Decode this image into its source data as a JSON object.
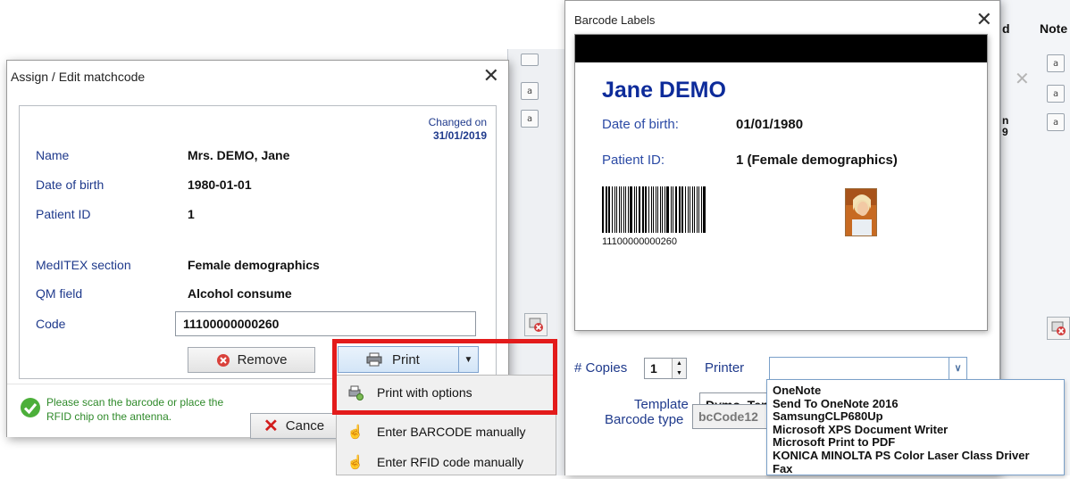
{
  "dialog_assign": {
    "title": "Assign / Edit matchcode",
    "close_symbol": "✕",
    "changed_on_label": "Changed on",
    "changed_on_date": "31/01/2019",
    "fields": [
      {
        "label": "Name",
        "value": "Mrs. DEMO, Jane"
      },
      {
        "label": "Date of birth",
        "value": "1980-01-01"
      },
      {
        "label": "Patient ID",
        "value": "1"
      },
      {
        "label": "MedITEX section",
        "value": "Female demographics"
      },
      {
        "label": "QM field",
        "value": "Alcohol consume"
      }
    ],
    "code_label": "Code",
    "code_value": "11100000000260",
    "remove_label": "Remove",
    "print_label": "Print",
    "cancel_label": "Cance",
    "status_message": "Please scan the barcode or place the RFID chip on the antenna."
  },
  "print_menu": {
    "items": [
      {
        "label": "Print with options",
        "icon": "print-options-icon"
      },
      {
        "label": "Enter BARCODE manually",
        "icon": "hand-icon"
      },
      {
        "label": "Enter RFID code manually",
        "icon": "hand-icon"
      }
    ]
  },
  "dialog_barcode": {
    "title": "Barcode Labels",
    "close_symbol": "✕",
    "card": {
      "name": "Jane DEMO",
      "dob_label": "Date of birth:",
      "dob_value": "01/01/1980",
      "pid_label": "Patient ID:",
      "pid_value": "1 (Female demographics)",
      "barcode_number": "11100000000260"
    },
    "copies_label": "# Copies",
    "copies_value": "1",
    "printer_label": "Printer",
    "printer_value": "",
    "template_label": "Template",
    "template_value": "Dymo_Ten",
    "barcode_type_label": "Barcode type",
    "barcode_type_value": "bcCode12",
    "printer_options": [
      "OneNote",
      "Send To OneNote 2016",
      "SamsungCLP680Up",
      "Microsoft XPS Document Writer",
      "Microsoft Print to PDF",
      "KONICA MINOLTA PS Color Laser Class Driver",
      "Fax"
    ]
  },
  "background_app": {
    "header_left": "d",
    "header_right": "Note",
    "peek_top": "n",
    "peek_bottom": "9"
  },
  "colors": {
    "label_blue": "#1f3a8c",
    "card_name_blue": "#0d2b9a",
    "status_green": "#2f8a2a",
    "highlight_red": "#e31b1b"
  }
}
